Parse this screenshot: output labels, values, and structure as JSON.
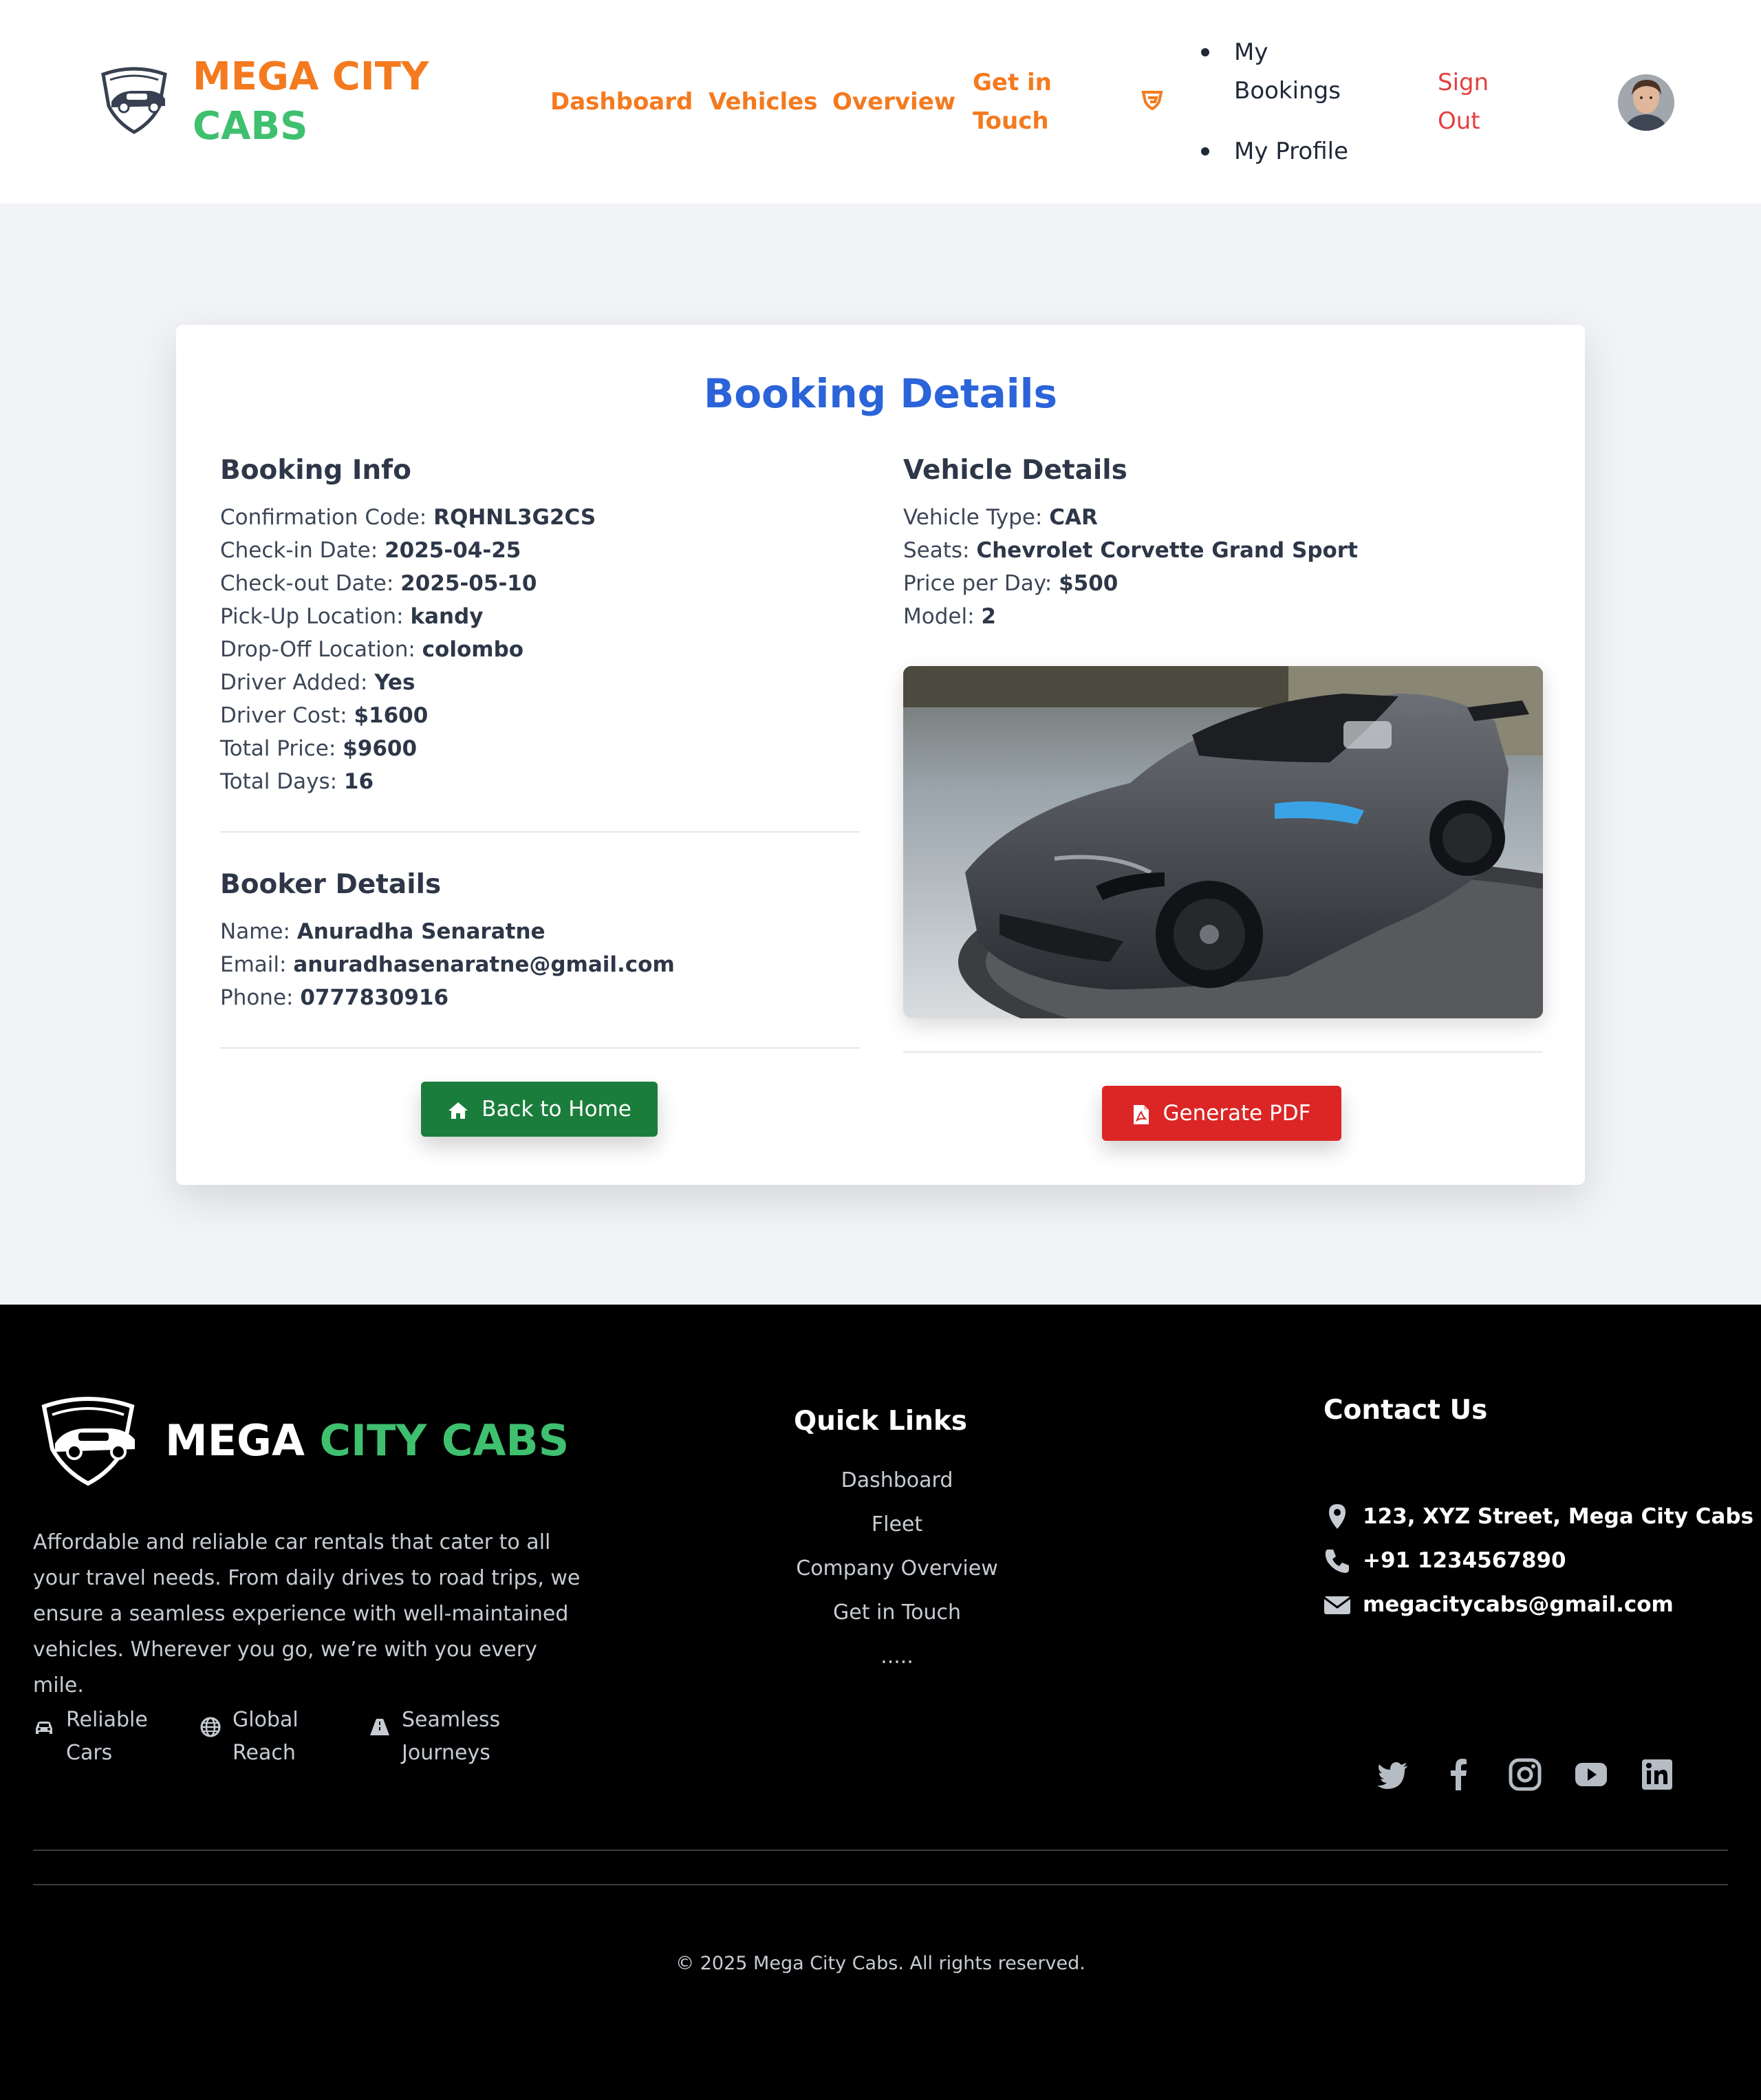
{
  "header": {
    "brand_word1": "MEGA CITY",
    "brand_word2": "CABS",
    "nav": {
      "dashboard": "Dashboard",
      "vehicles": "Vehicles",
      "overview": "Overview",
      "get_in_touch": "Get in Touch"
    },
    "menu_items": [
      "My Bookings",
      "My Profile"
    ],
    "sign_out": "Sign Out",
    "colors": {
      "brand_orange": "#f47a1f",
      "brand_green": "#3fc06f",
      "sign_out_red": "#e53e3e"
    }
  },
  "booking": {
    "title": "Booking Details",
    "info": {
      "title": "Booking Info",
      "rows": [
        {
          "label": "Confirmation Code:",
          "value": "RQHNL3G2CS"
        },
        {
          "label": "Check-in Date:",
          "value": "2025-04-25"
        },
        {
          "label": "Check-out Date:",
          "value": "2025-05-10"
        },
        {
          "label": "Pick-Up Location:",
          "value": "kandy"
        },
        {
          "label": "Drop-Off Location:",
          "value": "colombo"
        },
        {
          "label": "Driver Added:",
          "value": "Yes"
        },
        {
          "label": "Driver Cost:",
          "value": "$1600"
        },
        {
          "label": "Total Price:",
          "value": "$9600"
        },
        {
          "label": "Total Days:",
          "value": "16"
        }
      ]
    },
    "booker": {
      "title": "Booker Details",
      "rows": [
        {
          "label": "Name:",
          "value": "Anuradha Senaratne"
        },
        {
          "label": "Email:",
          "value": "anuradhasenaratne@gmail.com"
        },
        {
          "label": "Phone:",
          "value": "0777830916"
        }
      ]
    },
    "vehicle": {
      "title": "Vehicle Details",
      "rows": [
        {
          "label": "Vehicle Type:",
          "value": "CAR"
        },
        {
          "label": "Seats:",
          "value": "Chevrolet Corvette Grand Sport"
        },
        {
          "label": "Price per Day:",
          "value": "$500"
        },
        {
          "label": "Model:",
          "value": "2"
        }
      ]
    },
    "buttons": {
      "back_home": "Back to Home",
      "generate_pdf": "Generate PDF"
    },
    "colors": {
      "title_blue": "#2b63d9",
      "green_button": "#1b7d3b",
      "red_button": "#dc2626"
    }
  },
  "footer": {
    "brand_word1": "MEGA",
    "brand_word2": "CITY CABS",
    "description": "Affordable and reliable car rentals that cater to all your travel needs. From daily drives to road trips, we ensure a seamless experience with well-maintained vehicles. Wherever you go, we’re with you every mile.",
    "features": [
      {
        "icon": "car-icon",
        "line1": "Reliable",
        "line2": "Cars"
      },
      {
        "icon": "globe-icon",
        "line1": "Global",
        "line2": "Reach"
      },
      {
        "icon": "road-icon",
        "line1": "Seamless",
        "line2": "Journeys"
      }
    ],
    "quick_links": {
      "title": "Quick Links",
      "links": [
        "Dashboard",
        "Fleet",
        "Company Overview",
        "Get in Touch",
        "....."
      ]
    },
    "contact": {
      "title": "Contact Us",
      "address": "123, XYZ Street, Mega City Cabs",
      "phone": "+91 1234567890",
      "email": "megacitycabs@gmail.com"
    },
    "social_icons": [
      "twitter-icon",
      "facebook-icon",
      "instagram-icon",
      "youtube-icon",
      "linkedin-icon"
    ],
    "copyright": "© 2025 Mega City Cabs. All rights reserved."
  }
}
